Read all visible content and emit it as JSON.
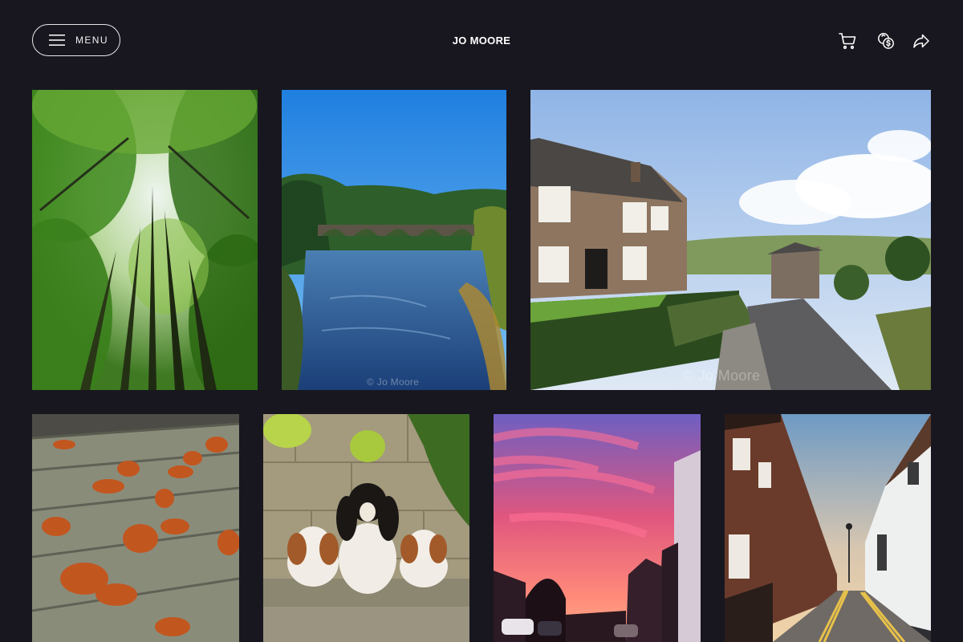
{
  "header": {
    "menu_label": "MENU",
    "brand": "JO MOORE",
    "icons": [
      "hamburger-icon",
      "cart-icon",
      "currency-exchange-icon",
      "share-icon"
    ]
  },
  "theme": {
    "background": "#18171f",
    "text": "#ffffff",
    "outline": "#e8e8ea"
  },
  "gallery": {
    "watermark_bridge": "© Jo Moore",
    "watermark_cottage": "© Jo Moore"
  }
}
